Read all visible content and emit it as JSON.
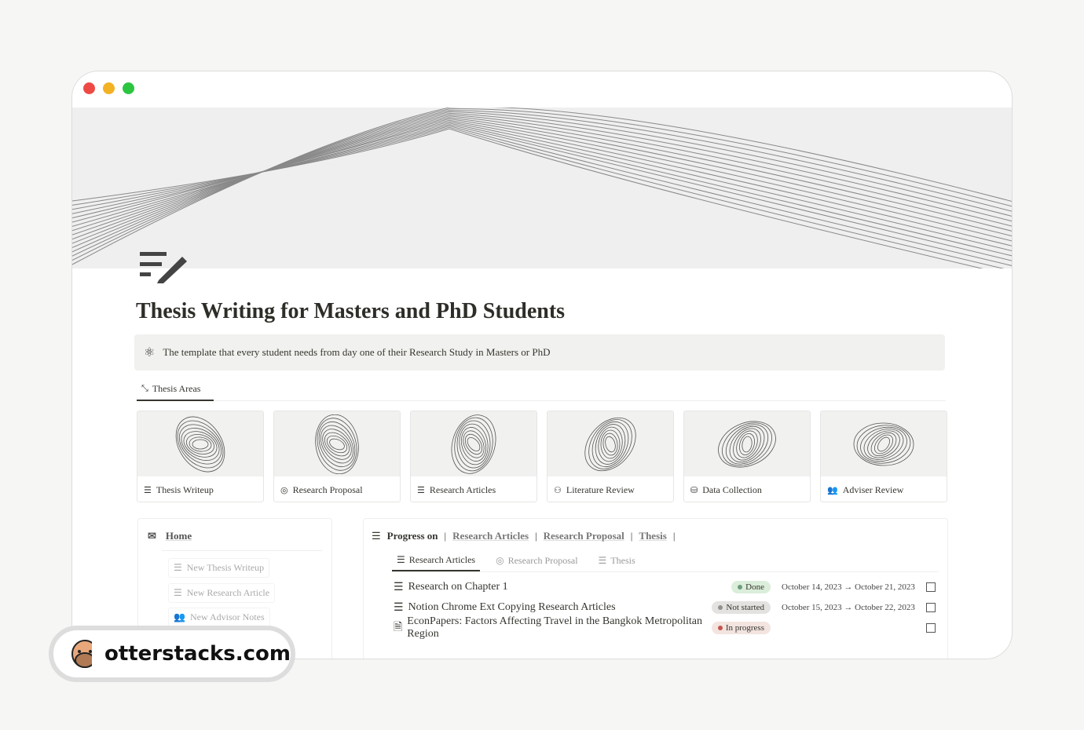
{
  "window": {
    "dot_colors": [
      "#ee4a45",
      "#f3b124",
      "#2bc540"
    ]
  },
  "page": {
    "icon": "thesis-writeup-icon",
    "title": "Thesis Writing for Masters and PhD Students",
    "callout": {
      "icon": "atom-icon",
      "text": "The template that every student needs from day one  of their Research Study in Masters or PhD"
    }
  },
  "tab": {
    "icon": "collapse-icon",
    "label": "Thesis Areas"
  },
  "gallery": [
    {
      "label": "Thesis Writeup",
      "icon": "writeup-icon"
    },
    {
      "label": "Research Proposal",
      "icon": "target-icon"
    },
    {
      "label": "Research Articles",
      "icon": "list-icon"
    },
    {
      "label": "Literature Review",
      "icon": "hierarchy-icon"
    },
    {
      "label": "Data Collection",
      "icon": "database-icon"
    },
    {
      "label": "Adviser Review",
      "icon": "people-icon"
    }
  ],
  "home": {
    "title": "Home",
    "buttons": [
      "New Thesis Writeup",
      "New Research Article",
      "New Advisor Notes"
    ]
  },
  "progress": {
    "prefix": "Progress on",
    "links": [
      "Research Articles",
      "Research Proposal",
      "Thesis"
    ],
    "tabs": [
      "Research Articles",
      "Research Proposal",
      "Thesis"
    ],
    "active_tab": "Research Articles",
    "rows": [
      {
        "name": "Research on Chapter 1",
        "status": "Done",
        "status_color": "#dbeddb",
        "dot": "#6c9b7d",
        "date": "October 14, 2023 → October 21, 2023",
        "checked": false
      },
      {
        "name": "Notion Chrome Ext Copying Research Articles",
        "status": "Not started",
        "status_color": "#e3e2e0",
        "dot": "#91918e",
        "date": "October 15, 2023 → October 22, 2023",
        "checked": false
      },
      {
        "name": "EconPapers: Factors Affecting Travel in the Bangkok Metropolitan Region",
        "status": "In progress",
        "status_color": "#f3e4e0",
        "dot": "#c4554d",
        "date": "",
        "checked": false
      }
    ]
  },
  "brand": {
    "text": "otterstacks.com",
    "logo": "otter-logo"
  }
}
